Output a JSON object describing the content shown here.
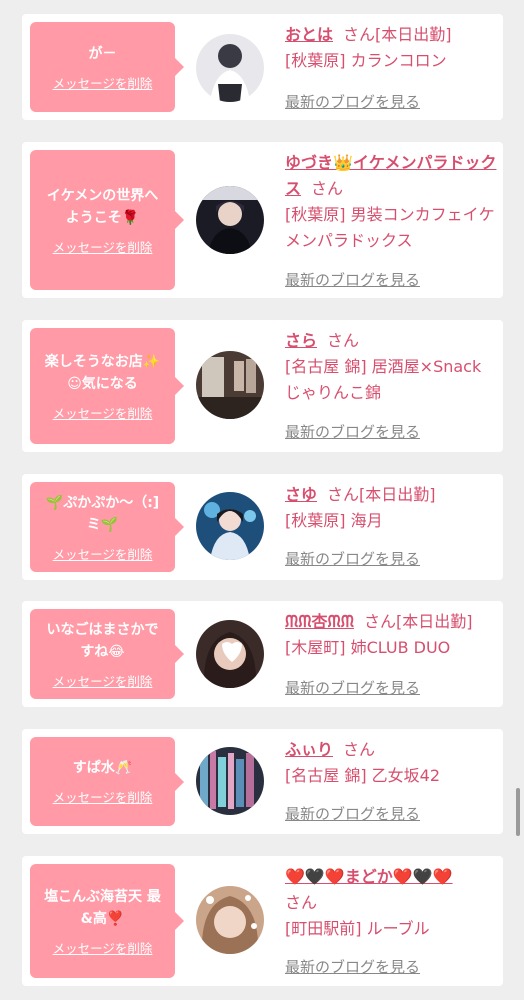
{
  "colors": {
    "accent": "#d74f6e",
    "bubble": "#ff9aa6",
    "muted": "#888888",
    "background": "#eeeeee"
  },
  "delete_label": "メッセージを削除",
  "blog_label": "最新のブログを見る",
  "cards": [
    {
      "message": "が－",
      "name": "おとは",
      "san": "さん",
      "status": "[本日出勤]",
      "location": "[秋葉原] カランコロン"
    },
    {
      "message": "イケメンの世界へ\nようこそ🌹",
      "name": "ゆづき👑イケメンパラドックス",
      "san": "さん",
      "status": "",
      "location": "[秋葉原] 男装コンカフェイケメンパラドックス"
    },
    {
      "message": "楽しそうなお店✨\n☺気になる",
      "name": "さら",
      "san": "さん",
      "status": "",
      "location": "[名古屋 錦] 居酒屋×Snack じゃりんこ錦"
    },
    {
      "message": "🌱ぷかぷか～（:]\nミ🌱",
      "name": "さゆ",
      "san": "さん",
      "status": "[本日出勤]",
      "location": "[秋葉原] 海月"
    },
    {
      "message": "いなごはまさかで\nすね😂",
      "name": "ᙏᙏ杏ᙏᙏ",
      "san": "さん",
      "status": "[本日出勤]",
      "location": "[木屋町] 姉CLUB DUO"
    },
    {
      "message": "すぱ水🥂",
      "name": "ふぃり",
      "san": "さん",
      "status": "",
      "location": "[名古屋 錦] 乙女坂42"
    },
    {
      "message": "塩こんぶ海苔天 最\n&高❣️",
      "name": "❤️🖤❤️まどか❤️🖤❤️",
      "san": "さん",
      "status": "",
      "location": "[町田駅前] ルーブル"
    }
  ]
}
